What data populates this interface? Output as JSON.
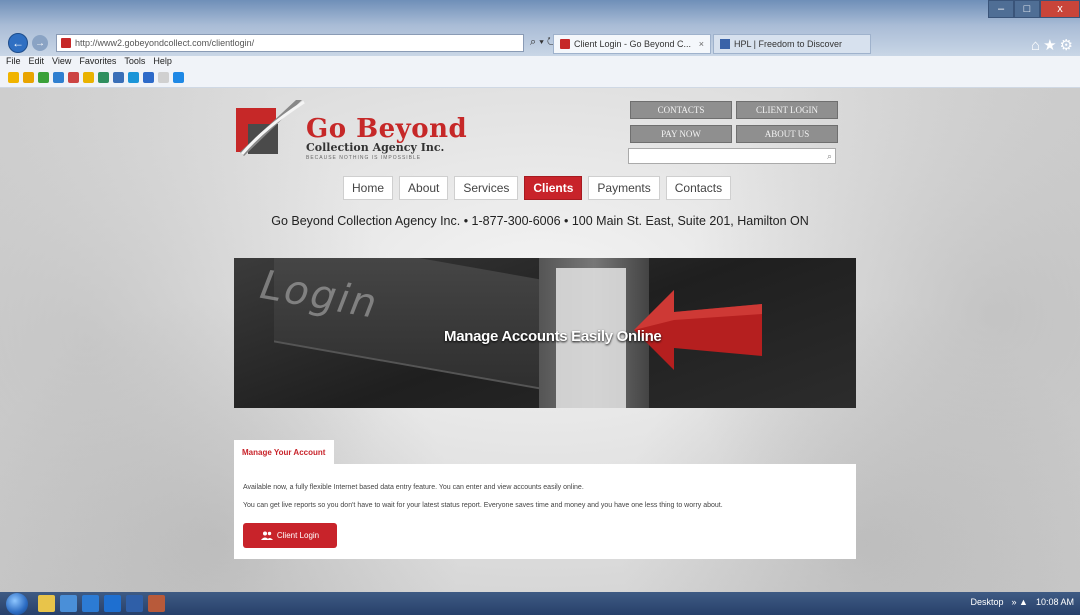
{
  "browser": {
    "url": "http://www2.gobeyondcollect.com/clientlogin/",
    "address_controls": "⌕ ▾ ↻",
    "tabs": [
      {
        "label": "Client Login - Go Beyond C...",
        "close": "×"
      },
      {
        "label": "HPL | Freedom to Discover"
      }
    ],
    "menu": [
      "File",
      "Edit",
      "View",
      "Favorites",
      "Tools",
      "Help"
    ],
    "window_controls": [
      "–",
      "□",
      "x"
    ],
    "home_star": "⌂★⚙"
  },
  "site": {
    "logo": {
      "title": "Go Beyond",
      "subtitle": "Collection Agency Inc.",
      "tagline": "BECAUSE NOTHING IS IMPOSSIBLE"
    },
    "top_buttons": {
      "contacts": "CONTACTS",
      "client_login": "CLIENT LOGIN",
      "pay_now": "PAY NOW",
      "about_us": "ABOUT US"
    },
    "search": {
      "icon": "⌕"
    },
    "nav": [
      {
        "label": "Home",
        "active": false
      },
      {
        "label": "About",
        "active": false
      },
      {
        "label": "Services",
        "active": false
      },
      {
        "label": "Clients",
        "active": true
      },
      {
        "label": "Payments",
        "active": false
      },
      {
        "label": "Contacts",
        "active": false
      }
    ],
    "contact_line": "Go Beyond Collection Agency Inc. • 1-877-300-6006 • 100 Main St. East, Suite 201, Hamilton ON",
    "hero": {
      "key_text": "Login",
      "title": "Manage Accounts Easily Online"
    },
    "account": {
      "tab_label": "Manage Your Account",
      "para1": "Available now, a fully flexible Internet based data entry feature. You can enter and view accounts easily online.",
      "para2": "You can get live reports so you don't have to wait for your latest status report. Everyone saves time and money and you have one less thing to worry about.",
      "button_label": "Client Login",
      "button_icon": "users-icon"
    },
    "accent_color": "#c8232a"
  },
  "taskbar": {
    "desktop_label": "Desktop",
    "clock": "10:08 AM"
  }
}
